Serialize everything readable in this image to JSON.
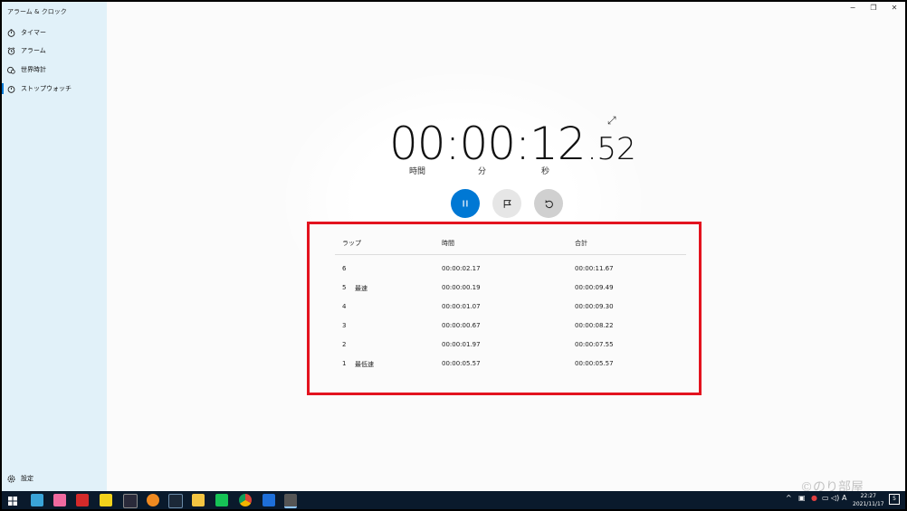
{
  "app": {
    "title": "アラーム & クロック"
  },
  "sidebar": {
    "items": [
      {
        "label": "タイマー",
        "icon": "timer-icon"
      },
      {
        "label": "アラーム",
        "icon": "alarm-icon"
      },
      {
        "label": "世界時計",
        "icon": "world-clock-icon"
      },
      {
        "label": "ストップウォッチ",
        "icon": "stopwatch-icon",
        "active": true
      }
    ],
    "settings_label": "設定"
  },
  "window_controls": {
    "minimize": "−",
    "restore": "❐",
    "close": "✕"
  },
  "stopwatch": {
    "time_main": "00:00:12",
    "time_fraction": ".52",
    "unit_hours": "時間",
    "unit_minutes": "分",
    "unit_seconds": "秒"
  },
  "laps": {
    "headers": {
      "lap": "ラップ",
      "time": "時間",
      "total": "合計"
    },
    "rows": [
      {
        "lap": "6",
        "tag": "",
        "time": "00:00:02.17",
        "total": "00:00:11.67"
      },
      {
        "lap": "5",
        "tag": "最速",
        "time": "00:00:00.19",
        "total": "00:00:09.49"
      },
      {
        "lap": "4",
        "tag": "",
        "time": "00:00:01.07",
        "total": "00:00:09.30"
      },
      {
        "lap": "3",
        "tag": "",
        "time": "00:00:00.67",
        "total": "00:00:08.22"
      },
      {
        "lap": "2",
        "tag": "",
        "time": "00:00:01.97",
        "total": "00:00:07.55"
      },
      {
        "lap": "1",
        "tag": "最低速",
        "time": "00:00:05.57",
        "total": "00:00:05.57"
      }
    ]
  },
  "taskbar": {
    "clock_time": "22:27",
    "clock_date": "2021/11/17",
    "ime": "A",
    "notification_count": "5"
  },
  "watermark": "©のり部屋",
  "colors": {
    "accent": "#0078d4",
    "highlight_border": "#e3131f",
    "sidebar": "#e1f1f9",
    "taskbar": "#0a1a2c"
  }
}
